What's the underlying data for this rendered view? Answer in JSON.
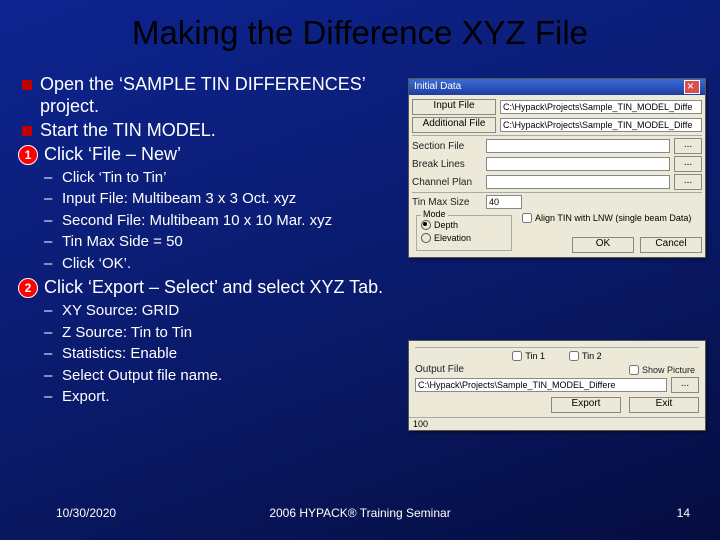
{
  "title": "Making the Difference XYZ File",
  "bullets": {
    "b1": "Open the ‘SAMPLE TIN DIFFERENCES’ project.",
    "b2": "Start the TIN MODEL.",
    "b3": "Click ‘File – New’",
    "b3_num": "1",
    "s3_1": "Click ‘Tin to Tin’",
    "s3_2": "Input File: Multibeam 3 x 3 Oct. xyz",
    "s3_3": "Second File: Multibeam 10 x 10 Mar. xyz",
    "s3_4": "Tin Max Side = 50",
    "s3_5": "Click ‘OK’.",
    "b4": "Click ‘Export – Select’ and select XYZ Tab.",
    "b4_num": "2",
    "s4_1": "XY Source:  GRID",
    "s4_2": "Z Source:  Tin to Tin",
    "s4_3": "Statistics:  Enable",
    "s4_4": "Select Output file name.",
    "s4_5": "Export."
  },
  "footer": {
    "date": "10/30/2020",
    "mid": "2006 HYPACK® Training Seminar",
    "page": "14"
  },
  "dlg1": {
    "title": "Initial Data",
    "lbl_input": "Input File",
    "val_input": "C:\\Hypack\\Projects\\Sample_TIN_MODEL_Diffe",
    "lbl_add": "Additional File",
    "val_add": "C:\\Hypack\\Projects\\Sample_TIN_MODEL_Diffe",
    "lbl_section": "Section File",
    "lbl_break": "Break Lines",
    "lbl_channel": "Channel Plan",
    "lbl_tinmax": "Tin Max Size",
    "val_tinmax": "40",
    "lbl_mode": "Mode",
    "opt_depth": "Depth",
    "opt_elev": "Elevation",
    "chk_align": "Align TIN with LNW (single beam Data)",
    "btn_ok": "OK",
    "btn_cancel": "Cancel",
    "btn_browse": "..."
  },
  "dlg2": {
    "chk_tin1": "Tin 1",
    "chk_tin2": "Tin 2",
    "lbl_output": "Output File",
    "chk_showpic": "Show Picture",
    "val_output": "C:\\Hypack\\Projects\\Sample_TIN_MODEL_Differe",
    "btn_export": "Export",
    "btn_exit": "Exit",
    "status": "100"
  }
}
